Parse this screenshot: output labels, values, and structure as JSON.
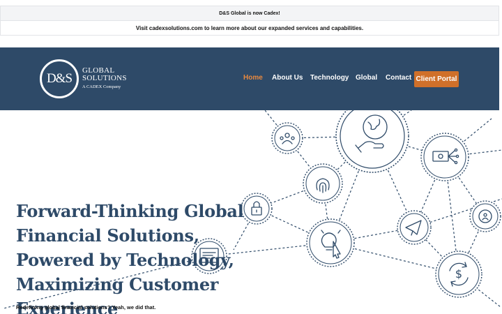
{
  "banner": {
    "notice": "D&S Global is now Cadex!",
    "info": "Visit cadexsolutions.com to learn more about our expanded services and capabilities."
  },
  "header": {
    "logo": {
      "mark": "D&S",
      "line1": "GLOBAL",
      "line2": "SOLUTIONS",
      "line3": "A CADEX Company"
    },
    "nav": {
      "home": "Home",
      "about": "About Us",
      "technology": "Technology",
      "global": "Global",
      "contact": "Contact",
      "portal": "Client Portal"
    },
    "colors": {
      "header_bg": "#2e4a68",
      "active": "#e8893f",
      "portal_bg": "#d0702a"
    }
  },
  "hero": {
    "headline": "Forward-Thinking Global Financial Solutions, Powered by Technology, Maximizing Customer Experience",
    "subline": "Redefining global financial solutions? Yeah, we did that.",
    "icons": [
      "team-icon",
      "globe-hand-icon",
      "money-network-icon",
      "fingerprint-icon",
      "lock-icon",
      "lightbulb-click-icon",
      "paper-plane-icon",
      "gear-people-icon",
      "document-icon",
      "dollar-refresh-icon"
    ]
  }
}
